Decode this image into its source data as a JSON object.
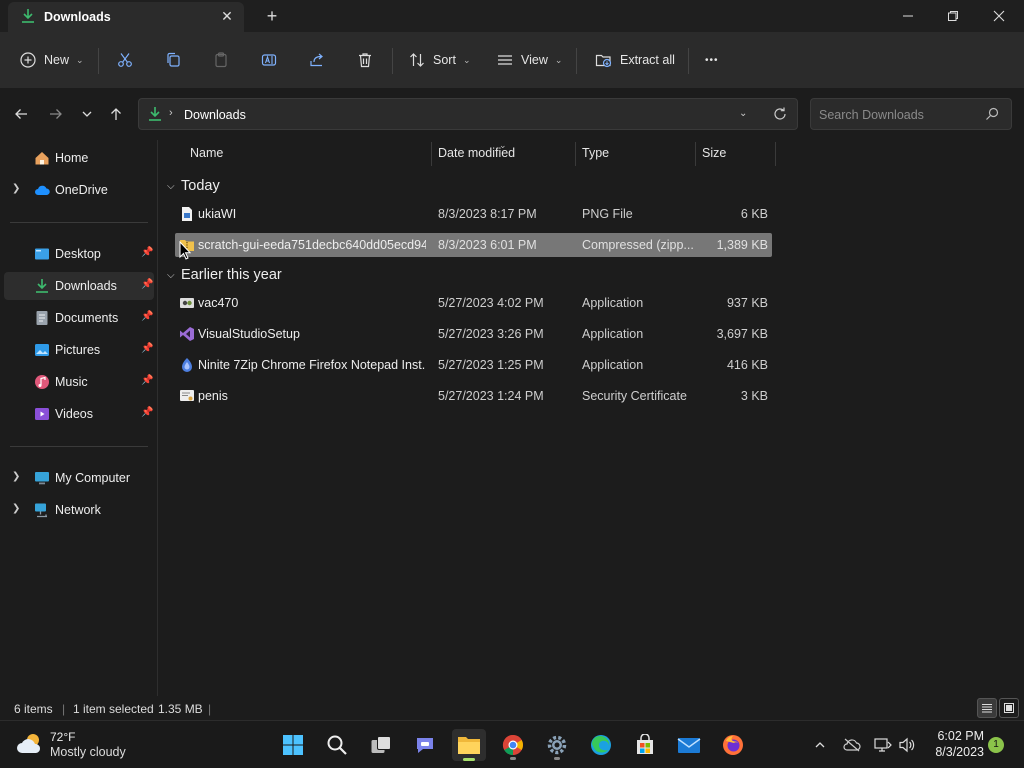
{
  "window": {
    "tab_title": "Downloads",
    "close_tab_glyph": "✕",
    "new_tab_glyph": "+"
  },
  "toolbar": {
    "new_label": "New",
    "sort_label": "Sort",
    "view_label": "View",
    "extract_label": "Extract all",
    "more_glyph": "•••"
  },
  "address": {
    "crumb": "Downloads"
  },
  "search": {
    "placeholder": "Search Downloads"
  },
  "sidebar": {
    "home": "Home",
    "onedrive": "OneDrive",
    "desktop": "Desktop",
    "downloads": "Downloads",
    "documents": "Documents",
    "pictures": "Pictures",
    "music": "Music",
    "videos": "Videos",
    "mycomputer": "My Computer",
    "network": "Network"
  },
  "columns": {
    "name": "Name",
    "date": "Date modified",
    "type": "Type",
    "size": "Size"
  },
  "groups": {
    "today": "Today",
    "earlier": "Earlier this year"
  },
  "files": [
    {
      "name": "ukiaWI",
      "date": "8/3/2023 8:17 PM",
      "type": "PNG File",
      "size": "6 KB"
    },
    {
      "name": "scratch-gui-eeda751decbc640dd05ecd94...",
      "date": "8/3/2023 6:01 PM",
      "type": "Compressed (zipp...",
      "size": "1,389 KB"
    },
    {
      "name": "vac470",
      "date": "5/27/2023 4:02 PM",
      "type": "Application",
      "size": "937 KB"
    },
    {
      "name": "VisualStudioSetup",
      "date": "5/27/2023 3:26 PM",
      "type": "Application",
      "size": "3,697 KB"
    },
    {
      "name": "Ninite 7Zip Chrome Firefox Notepad Inst...",
      "date": "5/27/2023 1:25 PM",
      "type": "Application",
      "size": "416 KB"
    },
    {
      "name": "penis",
      "date": "5/27/2023 1:24 PM",
      "type": "Security Certificate",
      "size": "3 KB"
    }
  ],
  "status": {
    "items": "6 items",
    "selected": "1 item selected",
    "size": "1.35 MB"
  },
  "taskbar": {
    "temp": "72°F",
    "condition": "Mostly cloudy",
    "time": "6:02 PM",
    "date": "8/3/2023",
    "notifications": "1"
  },
  "colors": {
    "accent_green": "#3dbb6e",
    "selection": "#777777",
    "background": "#1c1c1c"
  }
}
